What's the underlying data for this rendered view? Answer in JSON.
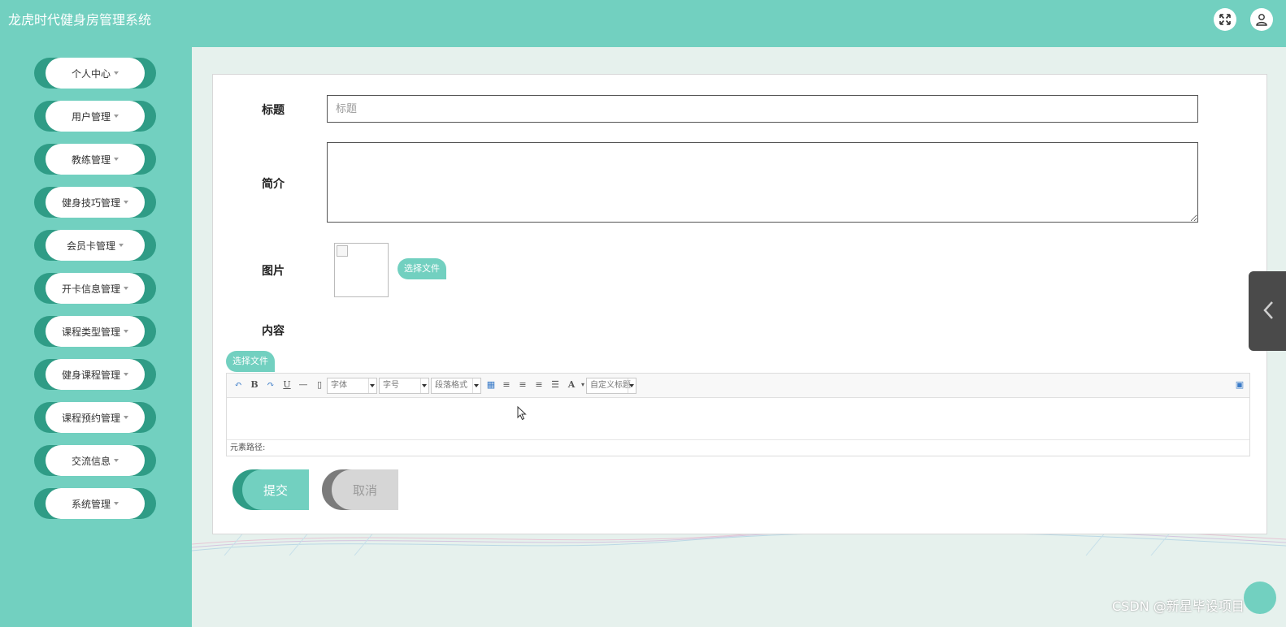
{
  "header": {
    "app_title": "龙虎时代健身房管理系统"
  },
  "sidebar": {
    "items": [
      {
        "label": "个人中心"
      },
      {
        "label": "用户管理"
      },
      {
        "label": "教练管理"
      },
      {
        "label": "健身技巧管理"
      },
      {
        "label": "会员卡管理"
      },
      {
        "label": "开卡信息管理"
      },
      {
        "label": "课程类型管理"
      },
      {
        "label": "健身课程管理"
      },
      {
        "label": "课程预约管理"
      },
      {
        "label": "交流信息"
      },
      {
        "label": "系统管理"
      }
    ]
  },
  "form": {
    "title_label": "标题",
    "title_placeholder": "标题",
    "title_value": "",
    "intro_label": "简介",
    "intro_value": "",
    "image_label": "图片",
    "image_upload_label": "选择文件",
    "content_label": "内容",
    "content_upload_label": "选择文件",
    "submit_label": "提交",
    "cancel_label": "取消"
  },
  "editor": {
    "font_family": "字体",
    "font_size": "字号",
    "paragraph_format": "段落格式",
    "custom_heading": "自定义标题",
    "element_path_label": "元素路径:",
    "tools": [
      "undo-icon",
      "bold-icon",
      "redo-icon",
      "underline-icon",
      "horizontal-rule-icon",
      "page-icon",
      "table-icon",
      "align-left-icon",
      "align-right-icon",
      "align-center-icon",
      "justify-icon",
      "font-color-icon",
      "source-icon"
    ]
  },
  "watermark": "CSDN @新星毕设项目",
  "colors": {
    "accent": "#72d0c0",
    "accent_dark": "#2f9c86"
  }
}
